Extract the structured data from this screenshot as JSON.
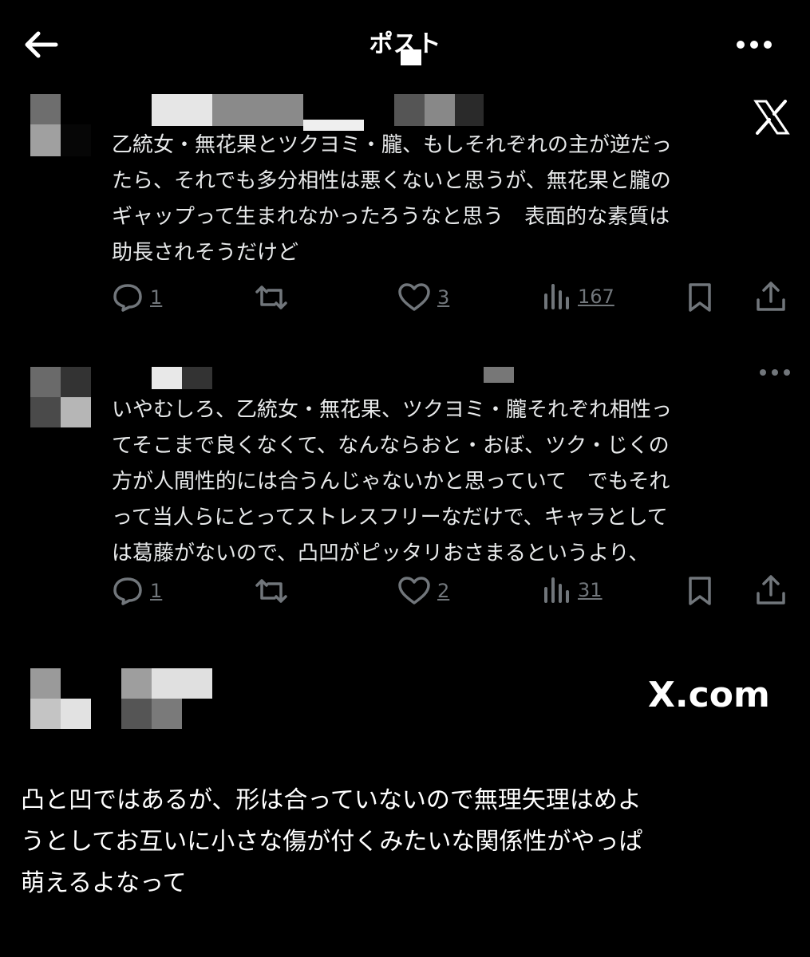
{
  "header": {
    "title": "ポスト"
  },
  "tweets": [
    {
      "text": "乙統女・無花果とツクヨミ・朧、もしそれぞれの主が逆だったら、それでも多分相性は悪くないと思うが、無花果と朧のギャップって生まれなかったろうなと思う　表面的な素質は助長されそうだけど",
      "lines": [
        "乙統女・無花果とツクヨミ・朧、もしそれぞれの主が逆だっ",
        "たら、それでも多分相性は悪くないと思うが、無花果と朧の",
        "ギャップって生まれなかったろうなと思う　表面的な素質は",
        "助長されそうだけど"
      ],
      "replies": "1",
      "likes": "3",
      "views": "167"
    },
    {
      "lines": [
        "いやむしろ、乙統女・無花果、ツクヨミ・朧それぞれ相性っ",
        "てそこまで良くなくて、なんならおと・おぼ、ツク・じくの",
        "方が人間性的には合うんじゃないかと思っていて　でもそれ",
        "って当人らにとってストレスフリーなだけで、キャラとして",
        "は葛藤がないので、凸凹がピッタリおさまるというより、"
      ],
      "replies": "1",
      "likes": "2",
      "views": "31"
    }
  ],
  "watermark": "X.com",
  "caption": {
    "lines": [
      "凸と凹ではあるが、形は合っていないので無理矢理はめよ",
      "うとしてお互いに小さな傷が付くみたいな関係性がやっぱ",
      "萌えるよなって"
    ]
  },
  "icons": [
    "back-arrow-icon",
    "more-icon",
    "x-logo-icon",
    "reply-icon",
    "repost-icon",
    "like-icon",
    "views-icon",
    "bookmark-icon",
    "share-icon"
  ],
  "colors": {
    "background": "#000000",
    "text": "#e7e9ea",
    "muted": "#71767b"
  }
}
